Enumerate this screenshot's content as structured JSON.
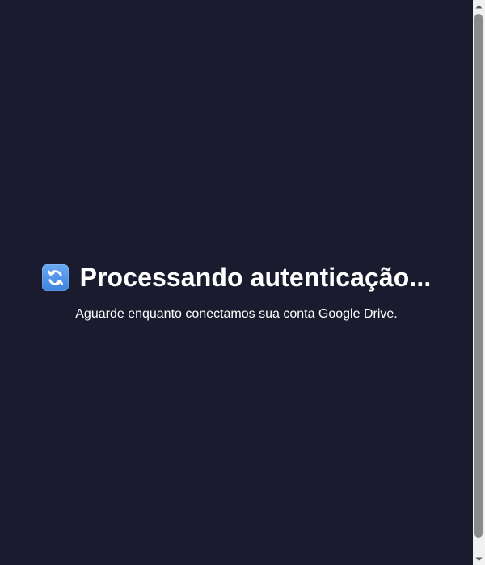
{
  "auth": {
    "icon": "arrows-counterclockwise-icon",
    "title": "Processando autenticação...",
    "message": "Aguarde enquanto conectamos sua conta Google Drive."
  },
  "colors": {
    "background": "#1a1b2e",
    "text": "#ffffff",
    "icon_background": "#4a90e2"
  },
  "scrollbar": {
    "up_icon": "scroll-up-arrow-icon",
    "down_icon": "scroll-down-arrow-icon"
  }
}
